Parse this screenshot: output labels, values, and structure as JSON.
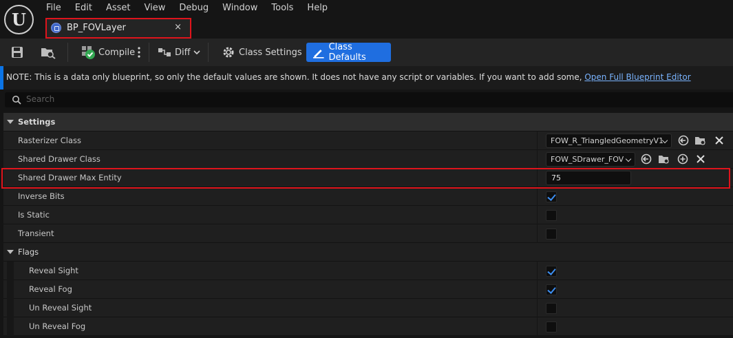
{
  "menu": [
    "File",
    "Edit",
    "Asset",
    "View",
    "Debug",
    "Window",
    "Tools",
    "Help"
  ],
  "tab": {
    "label": "BP_FOVLayer",
    "close": "×"
  },
  "toolbar": {
    "compile": "Compile",
    "diff": "Diff",
    "class_settings": "Class Settings",
    "class_defaults": "Class Defaults"
  },
  "note": {
    "text": "NOTE: This is a data only blueprint, so only the default values are shown.  It does not have any script or variables.  If you want to add some, ",
    "link": "Open Full Blueprint Editor"
  },
  "search": {
    "placeholder": "Search"
  },
  "settings": {
    "title": "Settings",
    "rasterizer_class": {
      "label": "Rasterizer Class",
      "value": "FOW_R_TriangledGeometryV1"
    },
    "shared_drawer_class": {
      "label": "Shared Drawer Class",
      "value": "FOW_SDrawer_FOV"
    },
    "shared_drawer_max_entity": {
      "label": "Shared Drawer Max Entity",
      "value": "75"
    },
    "inverse_bits": {
      "label": "Inverse Bits",
      "checked": true
    },
    "is_static": {
      "label": "Is Static",
      "checked": false
    },
    "transient": {
      "label": "Transient",
      "checked": false
    }
  },
  "flags": {
    "title": "Flags",
    "reveal_sight": {
      "label": "Reveal Sight",
      "checked": true
    },
    "reveal_fog": {
      "label": "Reveal Fog",
      "checked": true
    },
    "un_reveal_sight": {
      "label": "Un Reveal Sight",
      "checked": false
    },
    "un_reveal_fog": {
      "label": "Un Reveal Fog",
      "checked": false
    }
  },
  "colors": {
    "accent": "#1f6ee0",
    "highlight": "#e0141c",
    "check": "#3d8ff2"
  }
}
